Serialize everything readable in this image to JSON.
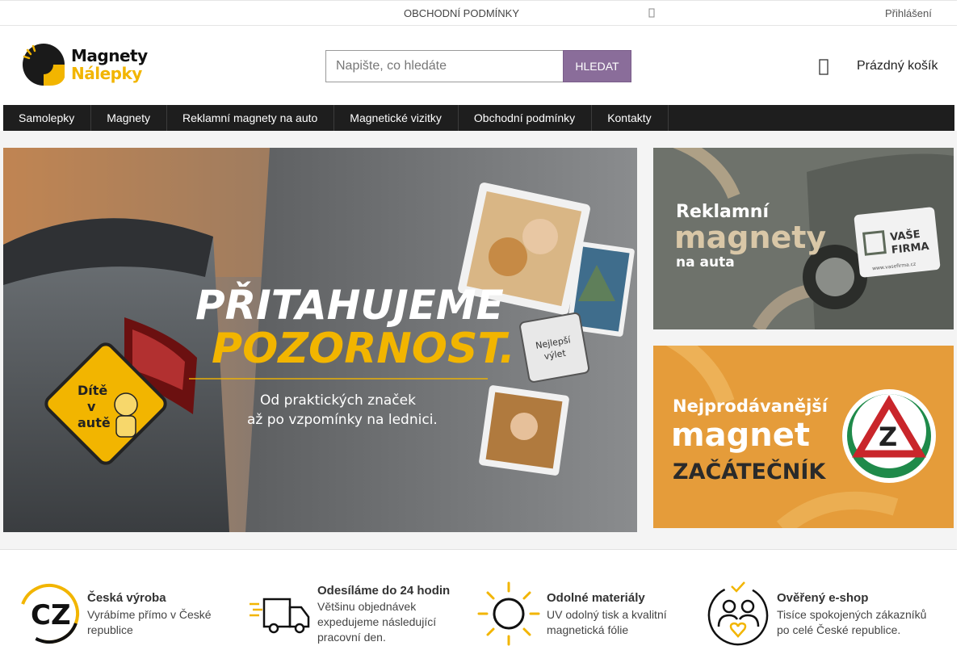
{
  "topbar": {
    "terms_link": "OBCHODNÍ PODMÍNKY",
    "login_link": "Přihlášení"
  },
  "logo": {
    "line1": "Magnety",
    "line2": "Nálepky"
  },
  "search": {
    "placeholder": "Napište, co hledáte",
    "button_label": "HLEDAT"
  },
  "cart": {
    "label": "Prázdný košík"
  },
  "nav": {
    "items": [
      "Samolepky",
      "Magnety",
      "Reklamní magnety na auto",
      "Magnetické vizitky",
      "Obchodní podmínky",
      "Kontakty"
    ]
  },
  "hero": {
    "headline1": "PŘITAHUJEME",
    "headline2": "POZORNOST.",
    "sub1": "Od praktických značek",
    "sub2": "až po vzpomínky na lednici.",
    "sign_text": [
      "Dítě",
      "v",
      "autě"
    ],
    "note_text": [
      "Nejlepší",
      "výlet"
    ]
  },
  "banner1": {
    "line1": "Reklamní",
    "line2": "magnety",
    "line3": "na auta",
    "door_line1": "VAŠE",
    "door_line2": "FIRMA",
    "door_url": "www.vasefirma.cz"
  },
  "banner2": {
    "line1": "Nejprodávanější",
    "line2": "magnet",
    "line3": "ZAČÁTEČNÍK",
    "badge_letter": "Z"
  },
  "features": [
    {
      "title": "Česká výroba",
      "text": "Vyrábíme přímo v České republice",
      "icon_text": "CZ"
    },
    {
      "title": "Odesíláme do 24 hodin",
      "text": "Většinu objednávek expedujeme následující pracovní den."
    },
    {
      "title": "Odolné materiály",
      "text": "UV odolný tisk a kvalitní magnetická fólie"
    },
    {
      "title": "Ověřený e-shop",
      "text": "Tisíce spokojených zákazníků po celé České republice."
    }
  ],
  "colors": {
    "accent": "#f2b500",
    "search_button": "#8a6d9a",
    "nav_bg": "#1e1e1e",
    "banner2_bg": "#e49b38",
    "banner1_bg": "#6b6f68"
  }
}
